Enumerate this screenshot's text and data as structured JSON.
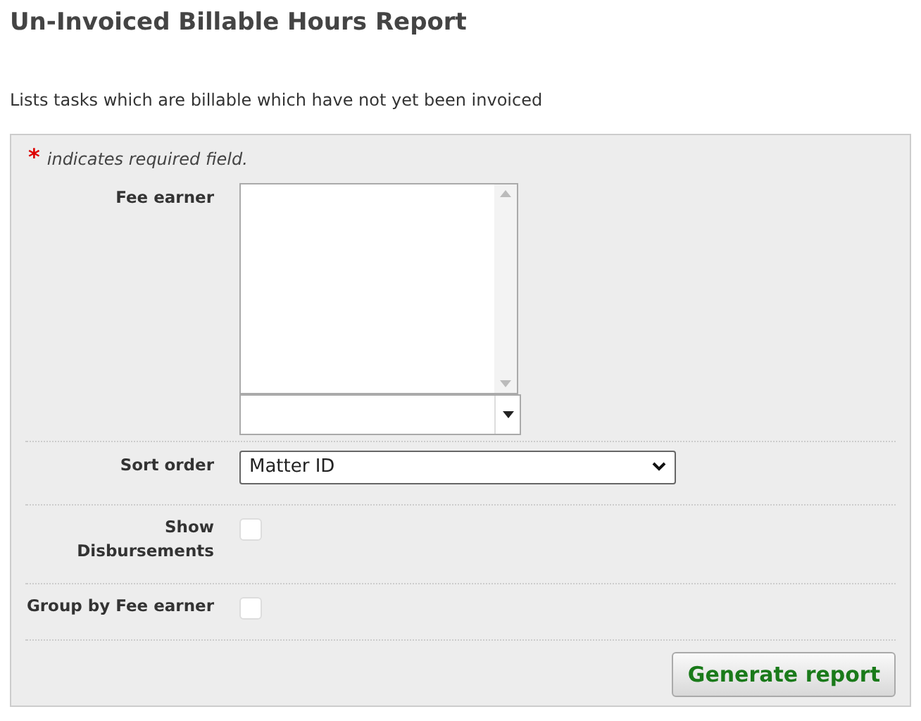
{
  "title": "Un-Invoiced Billable Hours Report",
  "description": "Lists tasks which are billable which have not yet been invoiced",
  "required_note": {
    "marker": "*",
    "text": "indicates required field."
  },
  "fields": [
    {
      "kind": "listbox",
      "label": "Fee earner"
    },
    {
      "kind": "select",
      "label": "Sort order",
      "value": "Matter ID"
    },
    {
      "kind": "checkbox",
      "label": "Show Disbursements",
      "checked": false
    },
    {
      "kind": "checkbox",
      "label": "Group by Fee earner",
      "checked": false
    }
  ],
  "submit_button": "Generate report"
}
